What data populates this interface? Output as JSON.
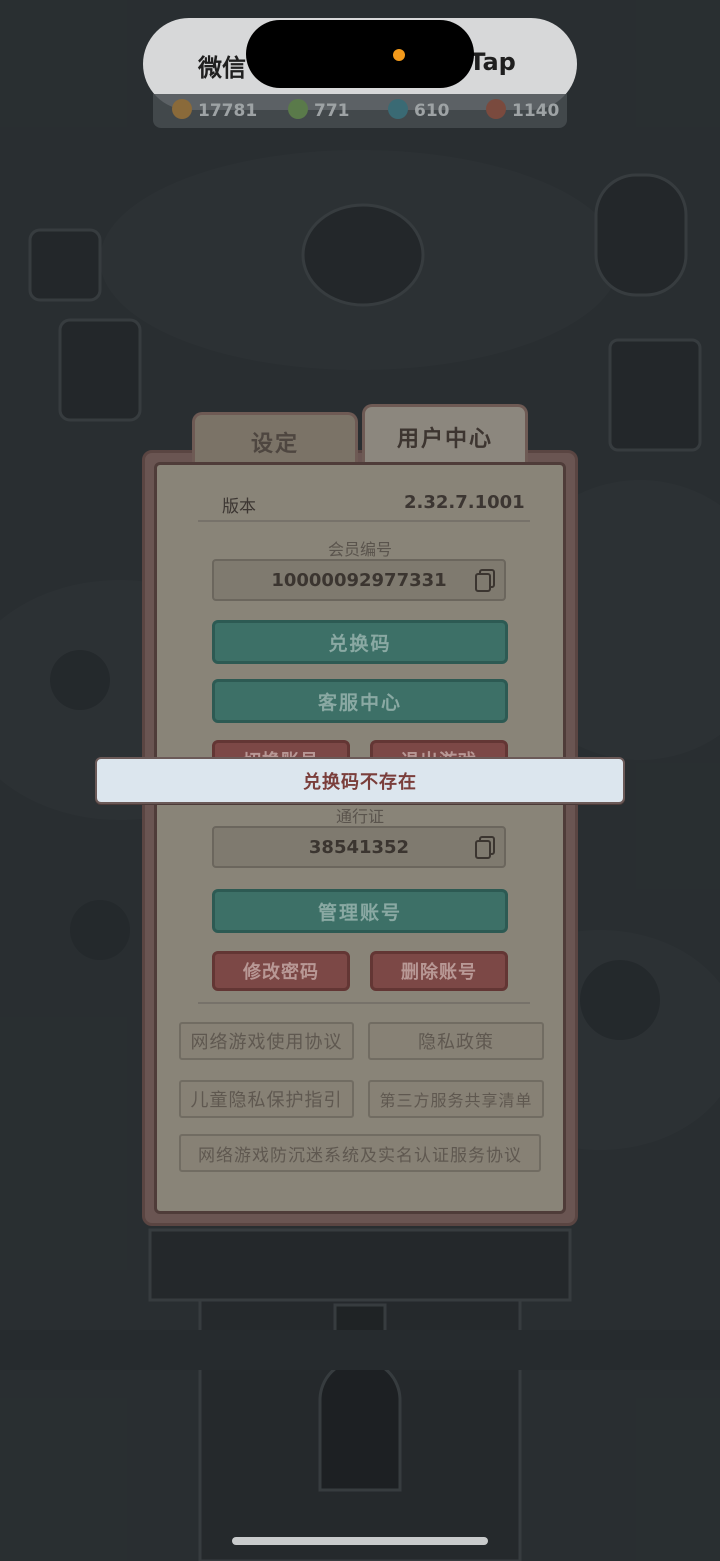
{
  "status_bar": {
    "left_text": "微信",
    "right_text": "pTap"
  },
  "resources": [
    {
      "value": "17781",
      "color": "#c98a3a"
    },
    {
      "value": "771",
      "color": "#6fa05a"
    },
    {
      "value": "610",
      "color": "#4a9aa8"
    },
    {
      "value": "1140",
      "color": "#c0604c"
    }
  ],
  "tabs": {
    "settings": "设定",
    "user_center": "用户中心"
  },
  "panel": {
    "version_label": "版本",
    "version_value": "2.32.7.1001",
    "member_id_label": "会员编号",
    "member_id_value": "10000092977331",
    "redeem_button": "兑换码",
    "support_button": "客服中心",
    "switch_account_button": "切换账号",
    "logout_button": "退出游戏",
    "pass_label": "通行证",
    "pass_value": "38541352",
    "manage_account_button": "管理账号",
    "change_password_button": "修改密码",
    "delete_account_button": "删除账号",
    "links": {
      "game_agreement": "网络游戏使用协议",
      "privacy_policy": "隐私政策",
      "child_privacy": "儿童隐私保护指引",
      "third_party": "第三方服务共享清单",
      "anti_addiction": "网络游戏防沉迷系统及实名认证服务协议"
    }
  },
  "toast": {
    "message": "兑换码不存在"
  }
}
